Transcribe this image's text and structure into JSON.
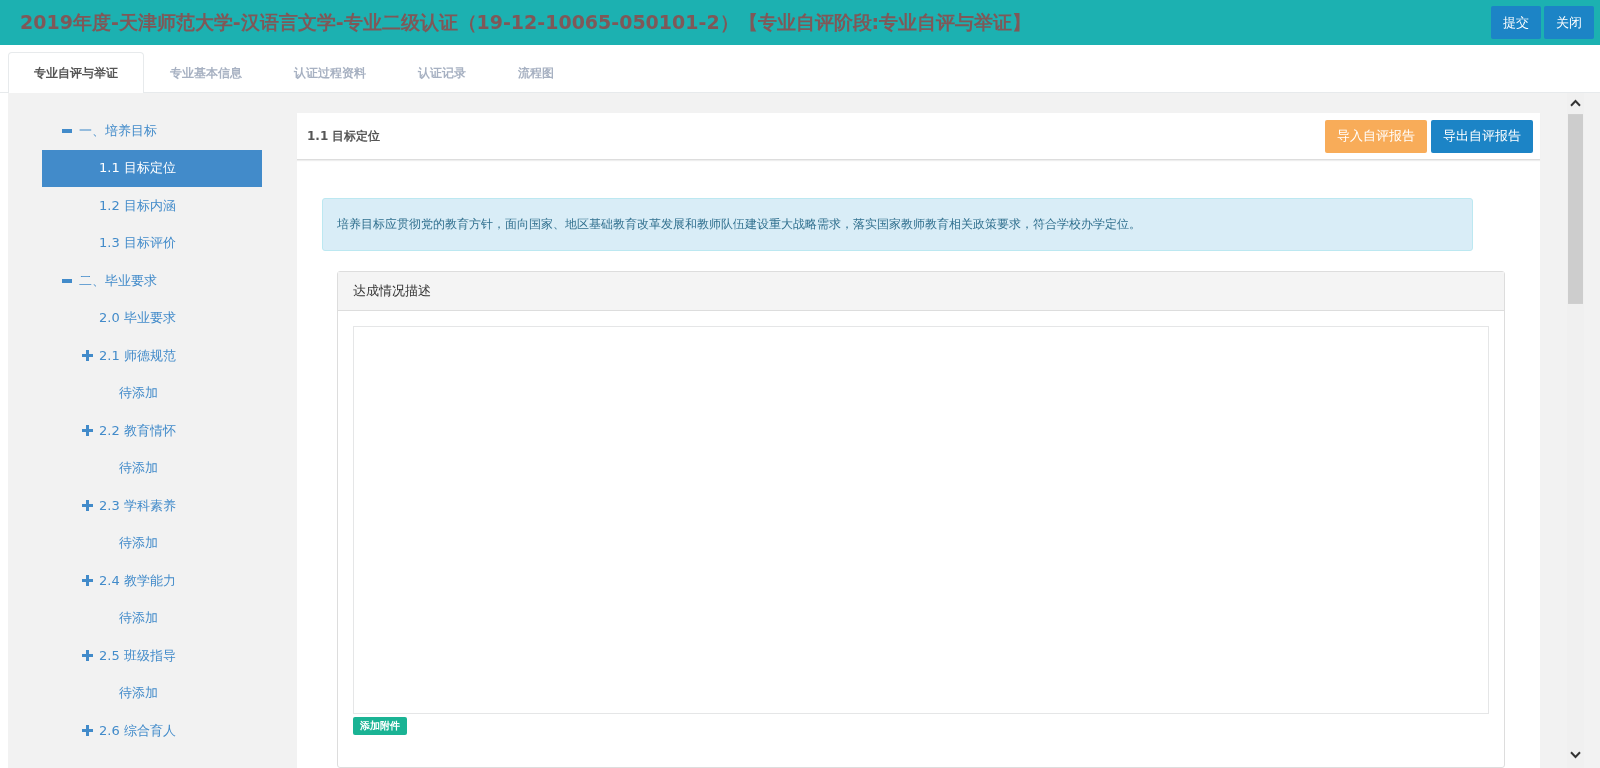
{
  "window": {
    "title": "2019年度-天津师范大学-汉语言文学-专业二级认证（19-12-10065-050101-2）【专业自评阶段:专业自评与举证】",
    "buttons": [
      "提交",
      "关闭"
    ]
  },
  "tabs": [
    {
      "label": "专业自评与举证",
      "selected": true
    },
    {
      "label": "专业基本信息",
      "selected": false
    },
    {
      "label": "认证过程资料",
      "selected": false
    },
    {
      "label": "认证记录",
      "selected": false
    },
    {
      "label": "流程图",
      "selected": false
    }
  ],
  "sidebar": {
    "items": [
      {
        "label": "一、培养目标",
        "expanded": true,
        "selected": false,
        "children": [
          {
            "label": "1.1 目标定位",
            "selected": true
          },
          {
            "label": "1.2 目标内涵",
            "selected": false
          },
          {
            "label": "1.3 目标评价",
            "selected": false
          }
        ]
      },
      {
        "label": "二、毕业要求",
        "expanded": true,
        "selected": false,
        "children": [
          {
            "label": "2.0 毕业要求",
            "selected": false
          },
          {
            "label": "2.1 师德规范",
            "expanded": false,
            "selected": false,
            "children": [
              {
                "label": "待添加",
                "selected": false
              }
            ]
          },
          {
            "label": "2.2 教育情怀",
            "expanded": false,
            "selected": false,
            "children": [
              {
                "label": "待添加",
                "selected": false
              }
            ]
          },
          {
            "label": "2.3 学科素养",
            "expanded": false,
            "selected": false,
            "children": [
              {
                "label": "待添加",
                "selected": false
              }
            ]
          },
          {
            "label": "2.4 教学能力",
            "expanded": false,
            "selected": false,
            "children": [
              {
                "label": "待添加",
                "selected": false
              }
            ]
          },
          {
            "label": "2.5 班级指导",
            "expanded": false,
            "selected": false,
            "children": [
              {
                "label": "待添加",
                "selected": false
              }
            ]
          },
          {
            "label": "2.6 综合育人",
            "expanded": false,
            "selected": false
          }
        ]
      }
    ]
  },
  "panel": {
    "title": "1.1 目标定位",
    "buttons": [
      {
        "label": "导入自评报告",
        "kind": "warning"
      },
      {
        "label": "导出自评报告",
        "kind": "primary"
      }
    ],
    "notice": "培养目标应贯彻党的教育方针，面向国家、地区基础教育改革发展和教师队伍建设重大战略需求，落实国家教师教育相关政策要求，符合学校办学定位。",
    "card": {
      "title": "达成情况描述",
      "attach_button": "添加附件"
    }
  }
}
